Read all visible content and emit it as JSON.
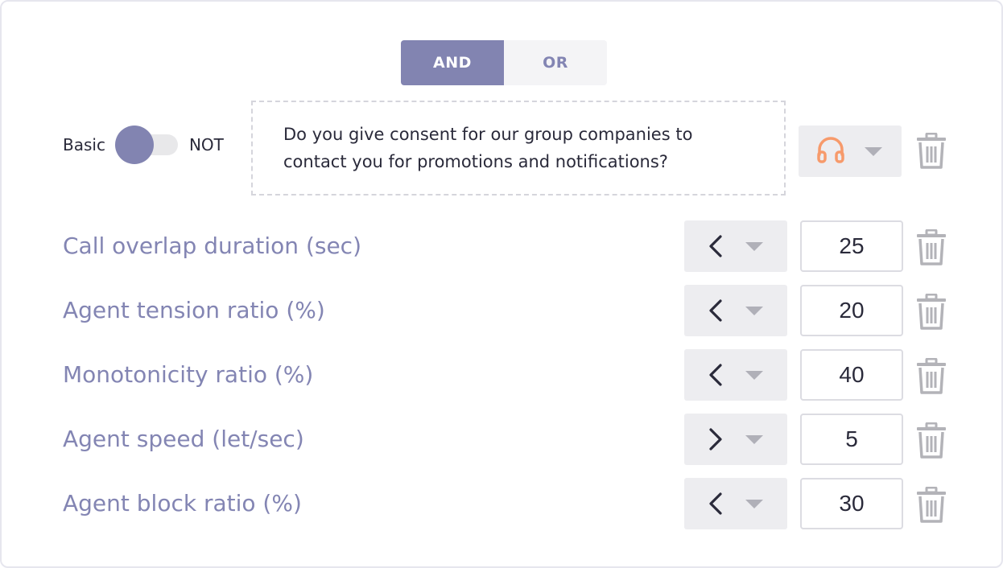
{
  "logic": {
    "and_label": "AND",
    "or_label": "OR",
    "selected": "AND"
  },
  "toggle": {
    "left_label": "Basic",
    "right_label": "NOT",
    "state": "Basic"
  },
  "question": {
    "text": "Do you give consent for our group companies to contact you for promotions and notifications?"
  },
  "channel": {
    "icon": "headphones-icon",
    "icon_color": "#f79a6b"
  },
  "colors": {
    "accent": "#8284b1",
    "label": "#8385b3",
    "control_bg": "#ededf0",
    "icon_gray": "#b3b3b8"
  },
  "metrics": [
    {
      "label": "Call overlap duration (sec)",
      "operator": "less-than",
      "value": "25"
    },
    {
      "label": "Agent tension ratio (%)",
      "operator": "less-than",
      "value": "20"
    },
    {
      "label": "Monotonicity ratio (%)",
      "operator": "less-than",
      "value": "40"
    },
    {
      "label": "Agent speed (let/sec)",
      "operator": "greater-than",
      "value": "5"
    },
    {
      "label": "Agent block ratio (%)",
      "operator": "less-than",
      "value": "30"
    }
  ]
}
